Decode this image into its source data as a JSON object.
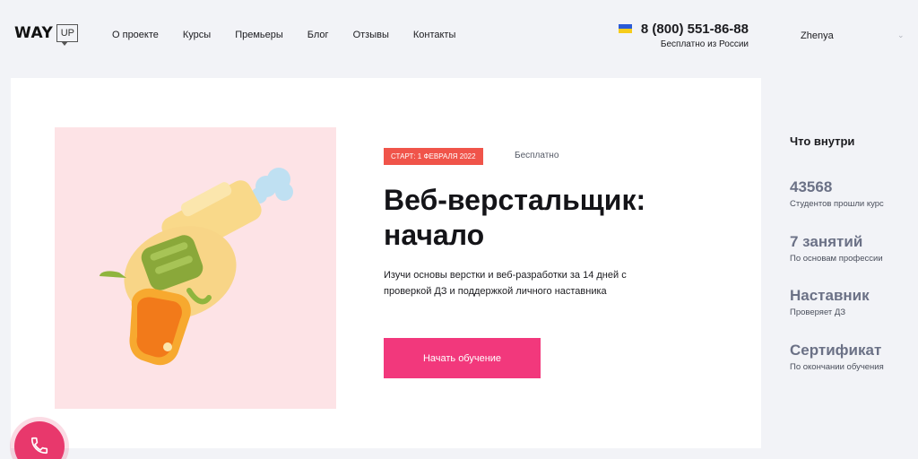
{
  "header": {
    "logo_main": "WAY",
    "logo_box": "UP",
    "nav": [
      {
        "label": "О проекте"
      },
      {
        "label": "Курсы"
      },
      {
        "label": "Премьеры"
      },
      {
        "label": "Блог"
      },
      {
        "label": "Отзывы"
      },
      {
        "label": "Контакты"
      }
    ],
    "phone": "8 (800) 551-86-88",
    "phone_note": "Бесплатно из России",
    "user_name": "Zhenya"
  },
  "course": {
    "start_badge": "Старт: 1 февраля 2022",
    "price": "Бесплатно",
    "title_line1": "Веб-верстальщик:",
    "title_line2": "начало",
    "description": "Изучи основы верстки и веб-разработки за 14 дней с проверкой ДЗ и поддержкой личного наставника",
    "cta_label": "Начать обучение"
  },
  "sidebar": {
    "title": "Что внутри",
    "stats": [
      {
        "value": "43568",
        "label": "Студентов прошли курс"
      },
      {
        "value": "7 занятий",
        "label": "По основам профессии"
      },
      {
        "value": "Наставник",
        "label": "Проверяет ДЗ"
      },
      {
        "value": "Сертификат",
        "label": "По окончании обучения"
      }
    ]
  },
  "colors": {
    "accent_pink": "#f2387c",
    "badge_red": "#f0544a",
    "illustration_bg": "#fde3e6"
  },
  "icons": {
    "phone_button": "phone-icon",
    "user_dropdown": "chevron-down-icon",
    "illustration": "toy-gun-illustration"
  }
}
